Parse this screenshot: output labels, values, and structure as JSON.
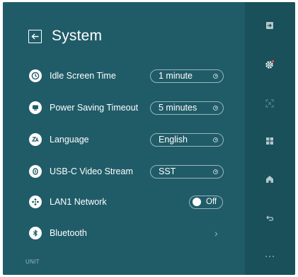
{
  "header": {
    "title": "System"
  },
  "settings": {
    "idle_screen_time": {
      "label": "Idle Screen Time",
      "value": "1 minute"
    },
    "power_saving_timeout": {
      "label": "Power Saving Timeout",
      "value": "5 minutes"
    },
    "language": {
      "label": "Language",
      "value": "English"
    },
    "usbc_video_stream": {
      "label": "USB-C Video Stream",
      "value": "SST"
    },
    "lan1_network": {
      "label": "LAN1 Network",
      "toggle_label": "Off",
      "enabled": false
    },
    "bluetooth": {
      "label": "Bluetooth"
    }
  },
  "footer": {
    "text": "UNIT"
  },
  "sidebar": {
    "items": [
      {
        "icon": "input-source-icon",
        "active": false
      },
      {
        "icon": "gear-icon",
        "active": true,
        "has_notification": true
      },
      {
        "icon": "zoom-icon",
        "active": false
      },
      {
        "icon": "grid-icon",
        "active": false
      },
      {
        "icon": "home-icon",
        "active": false
      },
      {
        "icon": "back-icon",
        "active": false
      },
      {
        "icon": "more-icon",
        "active": false
      }
    ]
  },
  "colors": {
    "background": "#205c68",
    "sidebar_background": "#19505a",
    "text": "#ffffff",
    "notification": "#e0506a"
  }
}
